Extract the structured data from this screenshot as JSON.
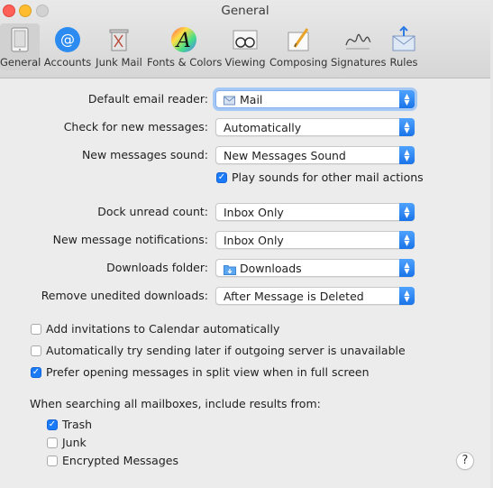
{
  "window": {
    "title": "General"
  },
  "toolbar": {
    "items": [
      {
        "label": "General",
        "icon": "general-icon"
      },
      {
        "label": "Accounts",
        "icon": "at-sign-icon"
      },
      {
        "label": "Junk Mail",
        "icon": "trash-bin-icon"
      },
      {
        "label": "Fonts & Colors",
        "icon": "fonts-colors-icon"
      },
      {
        "label": "Viewing",
        "icon": "glasses-icon"
      },
      {
        "label": "Composing",
        "icon": "pencil-paper-icon"
      },
      {
        "label": "Signatures",
        "icon": "signature-icon"
      },
      {
        "label": "Rules",
        "icon": "rules-envelope-icon"
      }
    ]
  },
  "settings": {
    "default_reader": {
      "label": "Default email reader:",
      "value": "Mail"
    },
    "check_messages": {
      "label": "Check for new messages:",
      "value": "Automatically"
    },
    "new_sound": {
      "label": "New messages sound:",
      "value": "New Messages Sound"
    },
    "play_sounds": {
      "label": "Play sounds for other mail actions",
      "checked": true
    },
    "dock_count": {
      "label": "Dock unread count:",
      "value": "Inbox Only"
    },
    "notifications": {
      "label": "New message notifications:",
      "value": "Inbox Only"
    },
    "downloads_folder": {
      "label": "Downloads folder:",
      "value": "Downloads"
    },
    "remove_downloads": {
      "label": "Remove unedited downloads:",
      "value": "After Message is Deleted"
    }
  },
  "options": {
    "calendar": {
      "label": "Add invitations to Calendar automatically",
      "checked": false
    },
    "send_later": {
      "label": "Automatically try sending later if outgoing server is unavailable",
      "checked": false
    },
    "split_view": {
      "label": "Prefer opening messages in split view when in full screen",
      "checked": true
    }
  },
  "search": {
    "heading": "When searching all mailboxes, include results from:",
    "items": [
      {
        "label": "Trash",
        "checked": true
      },
      {
        "label": "Junk",
        "checked": false
      },
      {
        "label": "Encrypted Messages",
        "checked": false
      }
    ]
  },
  "help": {
    "label": "?"
  },
  "colors": {
    "accent": "#1a7af8",
    "focus_ring": "#a5c8f5"
  }
}
